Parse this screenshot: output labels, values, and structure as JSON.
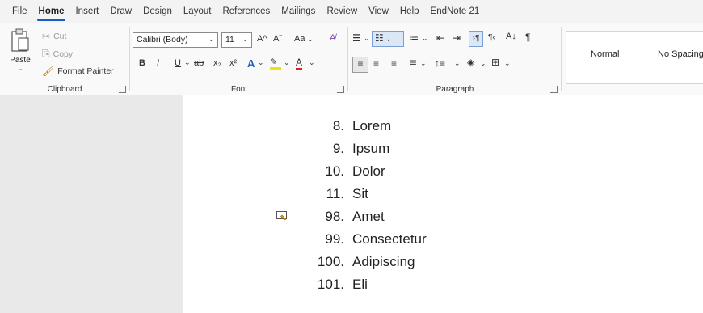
{
  "menu": {
    "tabs": [
      {
        "label": "File"
      },
      {
        "label": "Home",
        "active": true
      },
      {
        "label": "Insert"
      },
      {
        "label": "Draw"
      },
      {
        "label": "Design"
      },
      {
        "label": "Layout"
      },
      {
        "label": "References"
      },
      {
        "label": "Mailings"
      },
      {
        "label": "Review"
      },
      {
        "label": "View"
      },
      {
        "label": "Help"
      },
      {
        "label": "EndNote 21"
      }
    ]
  },
  "clipboard": {
    "paste_label": "Paste",
    "cut_label": "Cut",
    "copy_label": "Copy",
    "format_painter_label": "Format Painter",
    "group_label": "Clipboard"
  },
  "font": {
    "font_name": "Calibri (Body)",
    "font_size": "11",
    "change_case": "Aa",
    "bold": "B",
    "italic": "I",
    "underline": "U",
    "strikethrough": "ab",
    "subscript": "x₂",
    "superscript": "x²",
    "text_effects": "A",
    "font_color": "A",
    "grow": "A^",
    "shrink": "Aˇ",
    "group_label": "Font"
  },
  "paragraph": {
    "group_label": "Paragraph"
  },
  "styles": {
    "items": [
      {
        "label": "Normal"
      },
      {
        "label": "No Spacing"
      }
    ]
  },
  "document": {
    "list": [
      {
        "num": "8.",
        "text": "Lorem"
      },
      {
        "num": "9.",
        "text": "Ipsum"
      },
      {
        "num": "10.",
        "text": "Dolor"
      },
      {
        "num": "11.",
        "text": "Sit"
      },
      {
        "num": "98.",
        "text": "Amet"
      },
      {
        "num": "99.",
        "text": "Consectetur"
      },
      {
        "num": "100.",
        "text": "Adipiscing"
      },
      {
        "num": "101.",
        "text": "Eli"
      }
    ]
  },
  "colors": {
    "accent": "#185abd",
    "highlight_yellow": "#f2e200",
    "font_red": "#e02020"
  }
}
